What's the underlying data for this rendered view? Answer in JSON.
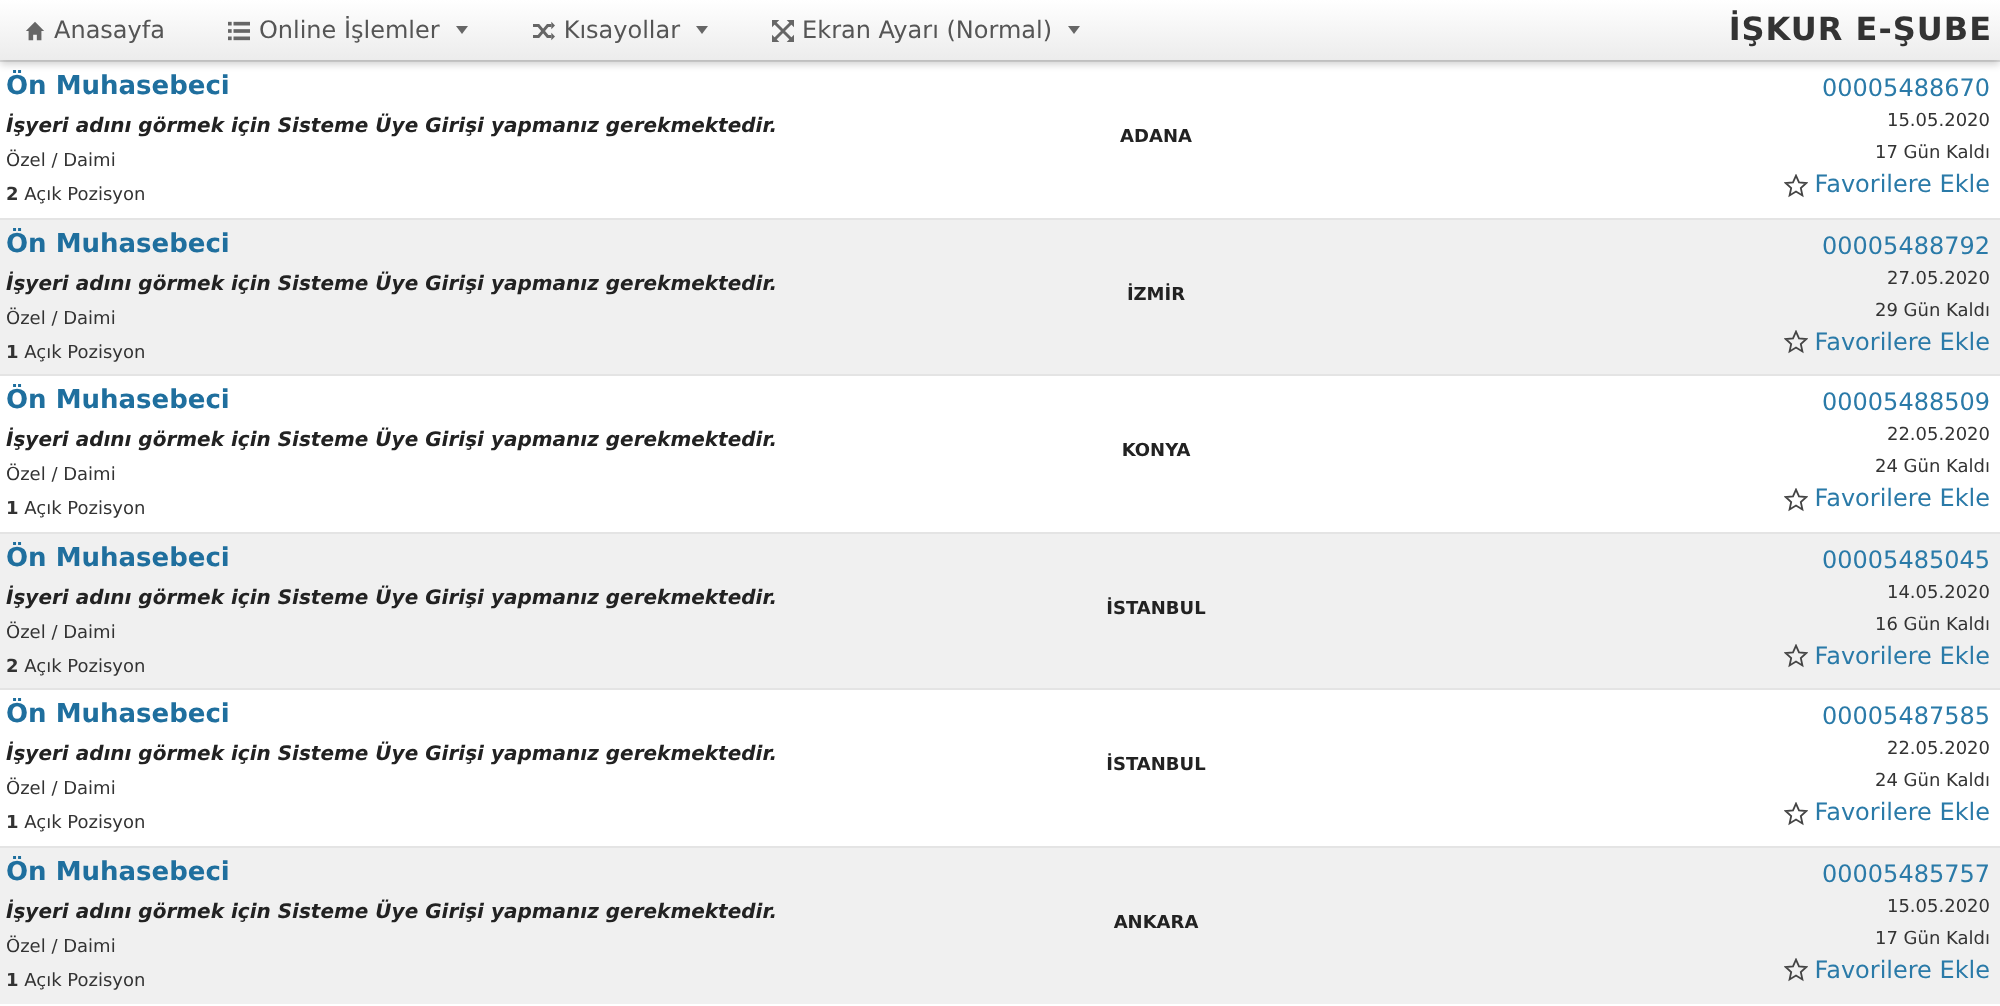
{
  "navbar": {
    "items": [
      {
        "kind": "home",
        "label": "Anasayfa",
        "dropdown": false
      },
      {
        "kind": "list",
        "label": "Online İşlemler",
        "dropdown": true
      },
      {
        "kind": "shuffle",
        "label": "Kısayollar",
        "dropdown": true
      },
      {
        "kind": "expand",
        "label": "Ekran Ayarı (Normal)",
        "dropdown": true
      }
    ],
    "brand": "İŞKUR E-ŞUBE"
  },
  "jobs": [
    {
      "title": "Ön Muhasebeci",
      "notice": "İşyeri adını görmek için Sisteme Üye Girişi yapmanız gerekmektedir.",
      "type": "Özel / Daimi",
      "positions": "**2** Açık Pozisyon",
      "city": "ADANA",
      "number": "00005488670",
      "date": "15.05.2020",
      "remaining": "17 Gün Kaldı",
      "favorite": "Favorilere Ekle"
    },
    {
      "title": "Ön Muhasebeci",
      "notice": "İşyeri adını görmek için Sisteme Üye Girişi yapmanız gerekmektedir.",
      "type": "Özel / Daimi",
      "positions": "**1** Açık Pozisyon",
      "city": "İZMİR",
      "number": "00005488792",
      "date": "27.05.2020",
      "remaining": "29 Gün Kaldı",
      "favorite": "Favorilere Ekle"
    },
    {
      "title": "Ön Muhasebeci",
      "notice": "İşyeri adını görmek için Sisteme Üye Girişi yapmanız gerekmektedir.",
      "type": "Özel / Daimi",
      "positions": "**1** Açık Pozisyon",
      "city": "KONYA",
      "number": "00005488509",
      "date": "22.05.2020",
      "remaining": "24 Gün Kaldı",
      "favorite": "Favorilere Ekle"
    },
    {
      "title": "Ön Muhasebeci",
      "notice": "İşyeri adını görmek için Sisteme Üye Girişi yapmanız gerekmektedir.",
      "type": "Özel / Daimi",
      "positions": "**2** Açık Pozisyon",
      "city": "İSTANBUL",
      "number": "00005485045",
      "date": "14.05.2020",
      "remaining": "16 Gün Kaldı",
      "favorite": "Favorilere Ekle"
    },
    {
      "title": "Ön Muhasebeci",
      "notice": "İşyeri adını görmek için Sisteme Üye Girişi yapmanız gerekmektedir.",
      "type": "Özel / Daimi",
      "positions": "**1** Açık Pozisyon",
      "city": "İSTANBUL",
      "number": "00005487585",
      "date": "22.05.2020",
      "remaining": "24 Gün Kaldı",
      "favorite": "Favorilere Ekle"
    },
    {
      "title": "Ön Muhasebeci",
      "notice": "İşyeri adını görmek için Sisteme Üye Girişi yapmanız gerekmektedir.",
      "type": "Özel / Daimi",
      "positions": "**1** Açık Pozisyon",
      "city": "ANKARA",
      "number": "00005485757",
      "date": "15.05.2020",
      "remaining": "17 Gün Kaldı",
      "favorite": "Favorilere Ekle"
    }
  ]
}
